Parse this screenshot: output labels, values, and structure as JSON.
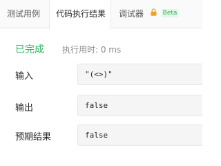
{
  "tabs": [
    {
      "label": "测试用例"
    },
    {
      "label": "代码执行结果"
    },
    {
      "label": "调试器",
      "badge": "Beta"
    }
  ],
  "result": {
    "status": "已完成",
    "runtime": "执行用时: 0 ms",
    "status_color": "#2db55d"
  },
  "rows": {
    "input": {
      "label": "输入",
      "value": "\"(<>)\""
    },
    "output": {
      "label": "输出",
      "value": "false"
    },
    "expected": {
      "label": "预期结果",
      "value": "false"
    }
  },
  "icons": {
    "lock": "lock-icon"
  },
  "colors": {
    "accent_green": "#2db55d",
    "lock_orange": "#f0a020",
    "badge_bg": "#e3f6e7"
  }
}
